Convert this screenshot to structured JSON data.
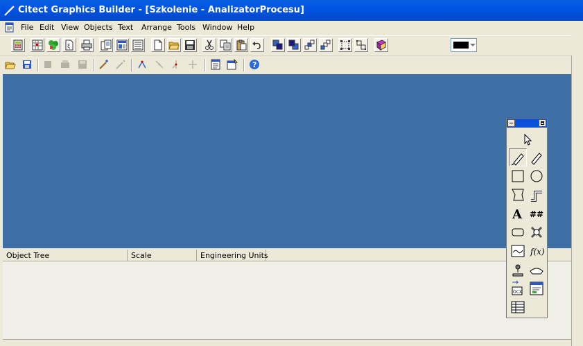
{
  "window": {
    "title": "Citect Graphics Builder - [Szkolenie - AnalizatorProcesu]"
  },
  "menu": {
    "items": [
      "File",
      "Edit",
      "View",
      "Objects",
      "Text",
      "Arrange",
      "Tools",
      "Window",
      "Help"
    ]
  },
  "toolbar": {
    "foreground_color": "#000000"
  },
  "object_tree": {
    "columns": [
      "Object Tree",
      "Scale",
      "Engineering Units"
    ]
  },
  "palette": {
    "tools": [
      "pointer",
      "freehand-line",
      "line",
      "rectangle",
      "ellipse",
      "polygon",
      "pipe",
      "text",
      "number",
      "button",
      "symbol-set",
      "trend",
      "cicode-object",
      "genie",
      "symbol",
      "swap-genie",
      "group",
      "table"
    ]
  },
  "colors": {
    "canvas": "#3d6fa5",
    "titlebar": "#0054e3"
  }
}
